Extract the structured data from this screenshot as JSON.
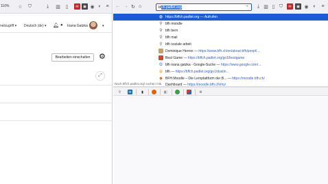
{
  "left_page": {
    "zoom": "110%",
    "lang_left": "nelzugriff ▾",
    "language": "Deutsch (de) ▾",
    "user": "Ioana Gatzka",
    "user_caret": "▾",
    "edit_button": "Bearbeiten einschalten"
  },
  "browser": {
    "url_typed": "bf",
    "url_selected": "ch.padlet.org",
    "url_after": "/",
    "suggestions": [
      {
        "icon": "padlet-icon",
        "text": "https://bffch.padlet.org",
        "sep": " — ",
        "link": "Aufrufen",
        "highlighted": true
      },
      {
        "icon": "search-icon",
        "text": "bfh moodle",
        "sep": "",
        "link": ""
      },
      {
        "icon": "search-icon",
        "text": "bfh bern",
        "sep": "",
        "link": ""
      },
      {
        "icon": "search-icon",
        "text": "bfh mail",
        "sep": "",
        "link": ""
      },
      {
        "icon": "search-icon",
        "text": "bfh soziale arbeit",
        "sep": "",
        "link": ""
      },
      {
        "icon": "page-icon",
        "text": "Dominique Herren",
        "sep": " — ",
        "link": "https://www.bfh.ch/en/about-bfh/peopl/..."
      },
      {
        "icon": "page-icon",
        "text": "Best Game",
        "sep": " — ",
        "link": "https://bffch.padlet.org/go1/bestgame"
      },
      {
        "icon": "google-icon",
        "text": "bfh ioana gatzka - Google-Suche",
        "sep": " — ",
        "link": "https://www.google.com/..."
      },
      {
        "icon": "padlet-icon",
        "text": "bfh",
        "sep": " — ",
        "link": "https://bffch.padlet.org/go1/dustin..."
      },
      {
        "icon": "moodle-icon",
        "text": "BFH Moodle – Die Lernplattform der B...",
        "sep": " — ",
        "link": "https://moodle.bfh.ch/"
      },
      {
        "icon": "page-icon",
        "text": "Dashboard",
        "sep": " — ",
        "link": "https://moodle.bfh.ch/my/"
      }
    ],
    "search_note": "Nach bffch.padlet.org/ suchen mit:"
  }
}
